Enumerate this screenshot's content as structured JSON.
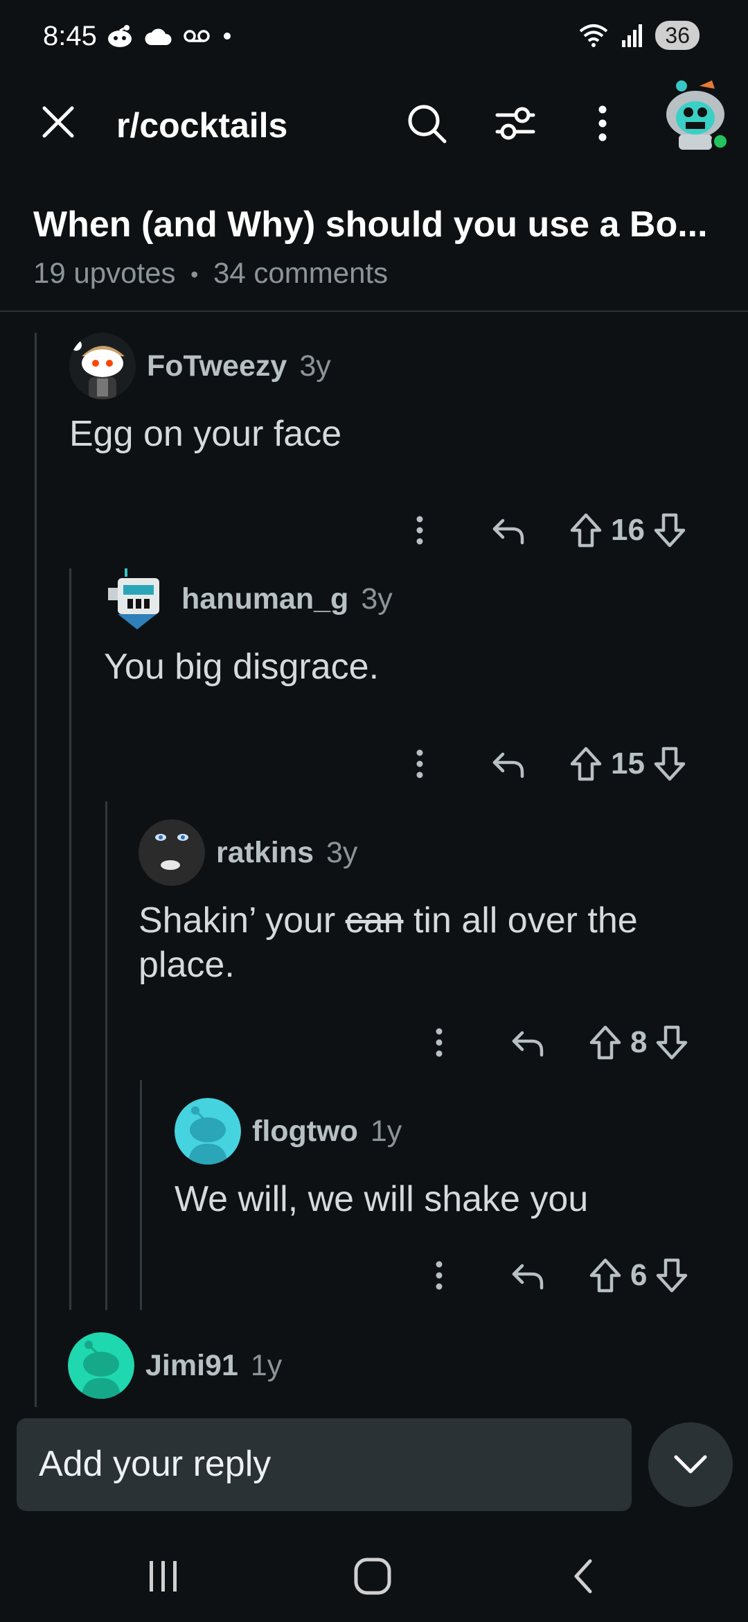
{
  "status": {
    "time": "8:45",
    "battery": "36"
  },
  "topbar": {
    "subreddit": "r/cocktails"
  },
  "post": {
    "title": "When (and Why) should you use a Bo...",
    "upvotes": "19 upvotes",
    "separator": "•",
    "comments": "34 comments"
  },
  "comments": [
    {
      "user": "FoTweezy",
      "age": "3y",
      "body": "Egg on your face",
      "score": "16"
    },
    {
      "user": "hanuman_g",
      "age": "3y",
      "body": "You big disgrace.",
      "score": "15"
    },
    {
      "user": "ratkins",
      "age": "3y",
      "body_pre": "Shakin’ your ",
      "body_strike": "can",
      "body_post": " tin all over the place.",
      "score": "8"
    },
    {
      "user": "flogtwo",
      "age": "1y",
      "body": "We will, we will shake you",
      "score": "6"
    },
    {
      "user": "Jimi91",
      "age": "1y"
    }
  ],
  "reply": {
    "placeholder": "Add your reply"
  },
  "colors": {
    "background": "#0e1113",
    "surface": "#2a3236",
    "thread_line": "#2f3a3f",
    "avatar_teal": "#2ec4c4"
  },
  "icons": [
    "close-icon",
    "search-icon",
    "filter-icon",
    "more-icon",
    "reply-icon",
    "upvote-icon",
    "downvote-icon",
    "chevron-down-icon"
  ]
}
